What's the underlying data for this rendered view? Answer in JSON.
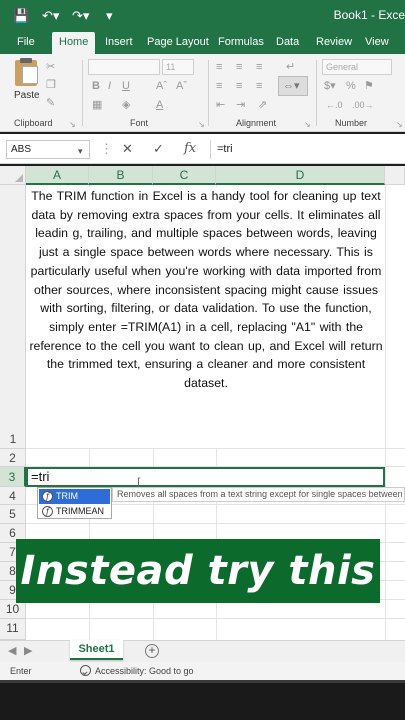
{
  "titlebar": {
    "title": "Book1 - Exce",
    "icons": [
      "save-icon",
      "undo-icon",
      "redo-icon",
      "customize-qat-icon"
    ]
  },
  "ribbon_tabs": [
    "File",
    "Home",
    "Insert",
    "Page Layout",
    "Formulas",
    "Data",
    "Review",
    "View"
  ],
  "active_tab": "Home",
  "ribbon": {
    "paste_label": "Paste",
    "groups": {
      "clipboard": "Clipboard",
      "font": "Font",
      "alignment": "Alignment",
      "number": "Number"
    },
    "font_size": "11",
    "number_format": "General"
  },
  "formula_bar": {
    "name_box": "ABS",
    "cancel_icon": "✕",
    "enter_icon": "✓",
    "fx_label": "fx",
    "content": "=tri"
  },
  "grid": {
    "columns": [
      "A",
      "B",
      "C",
      "D"
    ],
    "rows": [
      "1",
      "2",
      "3",
      "4",
      "5",
      "6",
      "7",
      "8",
      "9",
      "10",
      "11"
    ],
    "merged_text": "The TRIM function in     Excel is a    handy tool for cleaning   up        text data by removing    extra spaces from   your   cells.    It eliminates all           leadin g, trailing,   and multiple spaces between words,   leaving just a single space between words where necessary. This is particularly          useful   when   you're   working with data imported     from    other      sources, where inconsistent       spacing  might cause      issues with sorting,          filtering,       or data validation. To use the function, simply enter              =TRIM(A1) in a cell,             replacing \"A1\"      with the   reference to the cell you want to clean up,               and Excel will return the trimmed text,              ensuring a cleaner and more consistent dataset.",
    "active_cell_value": "=tri"
  },
  "autocomplete": {
    "items": [
      "TRIM",
      "TRIMMEAN"
    ],
    "selected": "TRIM",
    "tooltip": "Removes all spaces from a text string except for single spaces between words."
  },
  "banner": {
    "text": "Instead try this",
    "color": "#0b6a2c"
  },
  "sheets": {
    "tabs": [
      "Sheet1"
    ],
    "active": "Sheet1"
  },
  "status": {
    "mode": "Enter",
    "accessibility": "Accessibility: Good to go"
  },
  "colors": {
    "brand": "#217346",
    "selection": "#2e6dd8"
  }
}
